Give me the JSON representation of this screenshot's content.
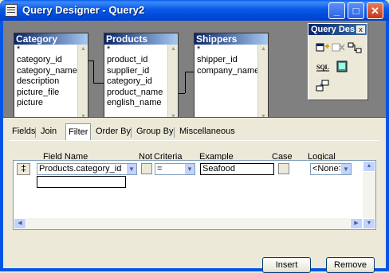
{
  "window": {
    "title": "Query Designer - Query2"
  },
  "title_buttons": {
    "minimize": "_",
    "maximize": "□",
    "close": "✕"
  },
  "tables": [
    {
      "name": "Category",
      "fields": [
        "*",
        "category_id",
        "category_name",
        "description",
        "picture_file",
        "picture"
      ]
    },
    {
      "name": "Products",
      "fields": [
        "*",
        "product_id",
        "supplier_id",
        "category_id",
        "product_name",
        "english_name"
      ]
    },
    {
      "name": "Shippers",
      "fields": [
        "*",
        "shipper_id",
        "company_name"
      ]
    }
  ],
  "toolbar": {
    "title": "Query Des",
    "close": "x",
    "buttons": [
      "add-table-icon",
      "remove-table-icon",
      "join-icon",
      "sql-icon",
      "run-icon",
      "link-icon"
    ],
    "sql_label": "SQL"
  },
  "tabs": [
    "Fields",
    "Join",
    "Filter",
    "Order By",
    "Group By",
    "Miscellaneous"
  ],
  "active_tab": "Filter",
  "filter": {
    "headers": [
      "Field Name",
      "Not",
      "Criteria",
      "Example",
      "Case",
      "Logical"
    ],
    "row": {
      "handle": "‡",
      "field_name": "Products.category_id",
      "criteria": "=",
      "example": "Seafood",
      "logical": "<None>"
    }
  },
  "buttons": {
    "insert": "Insert",
    "remove": "Remove"
  }
}
